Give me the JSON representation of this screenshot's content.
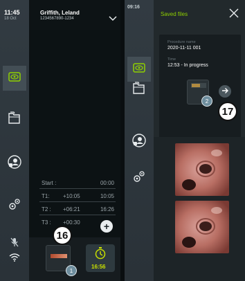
{
  "left": {
    "status": {
      "time": "11:45",
      "date": "18 Oct"
    },
    "patient": {
      "name": "Griffith, Leland",
      "id": "1234567890-1234"
    },
    "timers": [
      {
        "label": "Start :",
        "mid": "",
        "right": "00:00"
      },
      {
        "label": "T1:",
        "mid": "+10:05",
        "right": "10:05"
      },
      {
        "label": "T2 :",
        "mid": "+06:21",
        "right": "16:26"
      },
      {
        "label": "T3 :",
        "mid": "+00:30",
        "right": ""
      }
    ],
    "saved_count": "1",
    "timer_value": "16:56",
    "callout": "16"
  },
  "right": {
    "status": {
      "time": "09:16"
    },
    "title": "Saved files",
    "procedure_label": "Procedure name",
    "procedure_value": "2020-11-11 001",
    "time_label": "Time",
    "time_value": "12:53 - In progress",
    "file_count": "2",
    "callout": "17"
  },
  "colors": {
    "accent_green": "#8fd000",
    "timer_yellow": "#c8e000",
    "badge_blue": "#6e8e9e"
  },
  "icons": [
    "eye-icon",
    "folders-icon",
    "user-lock-icon",
    "gears-icon",
    "mic-off-icon",
    "wifi-icon",
    "stopwatch-icon",
    "close-icon",
    "arrow-right-icon",
    "plus-icon",
    "chevron-down-icon"
  ]
}
